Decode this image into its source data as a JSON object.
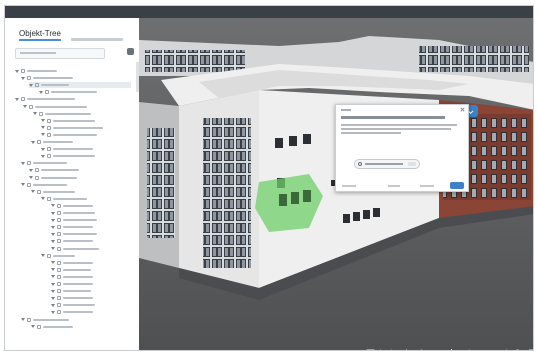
{
  "window": {
    "title": ""
  },
  "tabs": [
    {
      "label": "Objekt-Tree",
      "active": true
    }
  ],
  "tree": {
    "selected_index": 2
  },
  "toolbar": {
    "icons": [
      "section-icon",
      "orbit-icon",
      "pan-icon",
      "walk-icon",
      "camera-icon",
      "sun-icon",
      "measure-icon",
      "markup-icon",
      "explode-icon",
      "model-tree-icon",
      "properties-icon",
      "settings-icon",
      "fullscreen-icon"
    ]
  },
  "dialog": {
    "title": "",
    "subtitle": "",
    "chip_text": "",
    "footer_left": "",
    "footer_mid": "",
    "footer_right": "",
    "button_label": ""
  },
  "colors": {
    "accent": "#3b82c9",
    "selection": "#6fcf6a",
    "building_wall": "#e9e9e9",
    "roof": "#f0f0f0",
    "ground": "#5f6062",
    "window_frame": "#2b2f33",
    "brick": "#7b3b2e"
  }
}
